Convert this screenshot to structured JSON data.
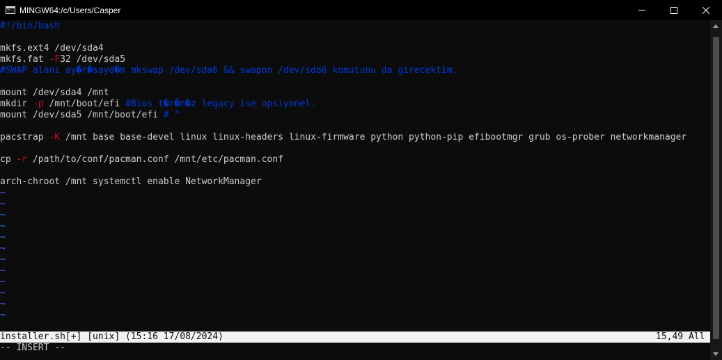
{
  "window": {
    "title": "MINGW64:/c/Users/Casper",
    "icon": "terminal-icon",
    "controls": {
      "minimize_icon": "minimize-icon",
      "maximize_icon": "maximize-icon",
      "close_icon": "close-icon"
    }
  },
  "colors": {
    "background": "#0c0c0c",
    "text": "#cccccc",
    "comment": "#0037da",
    "flag": "#c50f1f",
    "tilde": "#3b78ff",
    "statusline_bg": "#f2f2f2"
  },
  "editor": {
    "lines": [
      {
        "segments": [
          {
            "t": "#!/bin/bash",
            "k": "comment"
          }
        ]
      },
      {
        "segments": []
      },
      {
        "segments": [
          {
            "t": "mkfs.ext4 /dev/sda4",
            "k": "normal"
          }
        ]
      },
      {
        "segments": [
          {
            "t": "mkfs.fat ",
            "k": "normal"
          },
          {
            "t": "-F",
            "k": "flag"
          },
          {
            "t": "32 /dev/sda5",
            "k": "normal"
          }
        ]
      },
      {
        "segments": [
          {
            "t": "#SWAP alanı ay�r�sayd�m mkswap /dev/sda6 && swapon /dev/sda6 komutunu da girecektim.",
            "k": "comment"
          }
        ]
      },
      {
        "segments": []
      },
      {
        "segments": [
          {
            "t": "mount /dev/sda4 /mnt",
            "k": "normal"
          }
        ]
      },
      {
        "segments": [
          {
            "t": "mkdir ",
            "k": "normal"
          },
          {
            "t": "-p",
            "k": "flag"
          },
          {
            "t": " /mnt/boot/efi ",
            "k": "normal"
          },
          {
            "t": "#Bios t�r�n�z legacy ise opsiyonel.",
            "k": "comment"
          }
        ]
      },
      {
        "segments": [
          {
            "t": "mount /dev/sda5 /mnt/boot/efi ",
            "k": "normal"
          },
          {
            "t": "# \"",
            "k": "comment"
          }
        ]
      },
      {
        "segments": []
      },
      {
        "segments": [
          {
            "t": "pacstrap ",
            "k": "normal"
          },
          {
            "t": "-K",
            "k": "flag"
          },
          {
            "t": " /mnt base base-devel linux linux-headers linux-firmware python python-pip efibootmgr grub os-prober networkmanager",
            "k": "normal"
          }
        ]
      },
      {
        "segments": []
      },
      {
        "segments": [
          {
            "t": "cp ",
            "k": "normal"
          },
          {
            "t": "-r",
            "k": "flag"
          },
          {
            "t": " /path/to/conf/pacman.conf /mnt/etc/pacman.conf",
            "k": "normal"
          }
        ]
      },
      {
        "segments": []
      },
      {
        "segments": [
          {
            "t": "arch-chroot /mnt systemctl enable NetworkManager",
            "k": "normal"
          }
        ]
      }
    ],
    "tilde": "~",
    "tilde_count": 12,
    "statusline": {
      "left": "installer.sh[+] [unix] (15:16 17/08/2024)",
      "right": "15,49 All"
    },
    "mode": "-- INSERT --"
  }
}
